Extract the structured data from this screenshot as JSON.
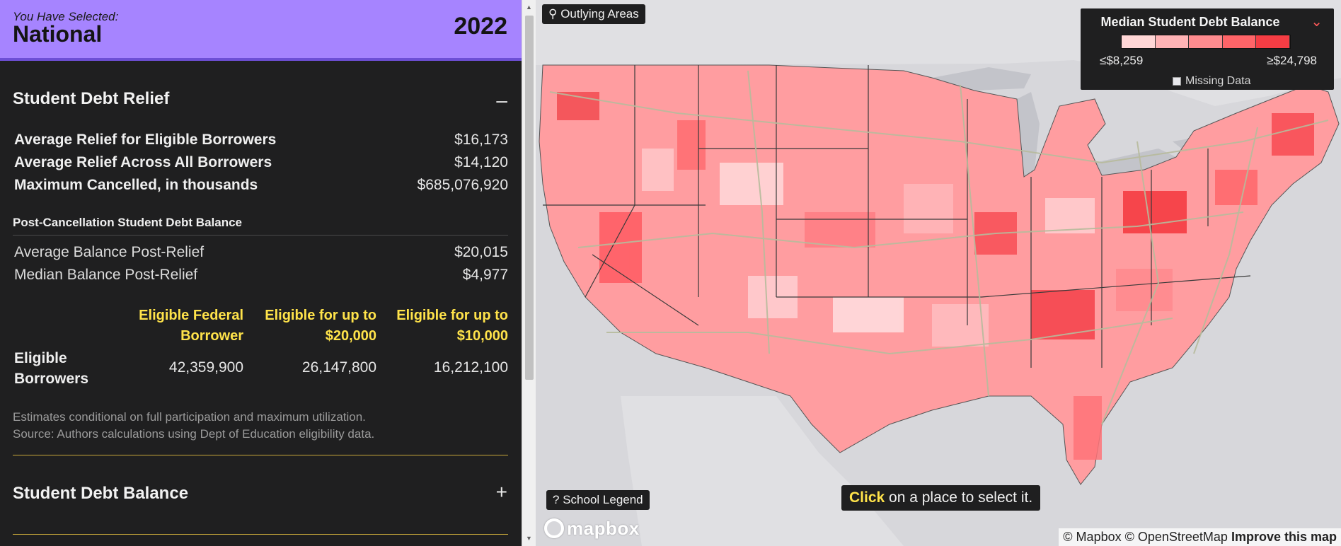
{
  "selection": {
    "kicker": "You Have Selected:",
    "name": "National",
    "year": "2022"
  },
  "relief": {
    "title": "Student Debt Relief",
    "toggle": "–",
    "stats": [
      {
        "label": "Average Relief for Eligible Borrowers",
        "value": "$16,173"
      },
      {
        "label": "Average Relief Across All Borrowers",
        "value": "$14,120"
      },
      {
        "label": "Maximum Cancelled, in thousands",
        "value": "$685,076,920"
      }
    ],
    "post_title": "Post-Cancellation Student Debt Balance",
    "post_stats": [
      {
        "label": "Average Balance Post-Relief",
        "value": "$20,015"
      },
      {
        "label": "Median Balance Post-Relief",
        "value": "$4,977"
      }
    ],
    "columns": [
      "Eligible Federal Borrower",
      "Eligible for up to $20,000",
      "Eligible for up to $10,000"
    ],
    "eligible_label": "Eligible Borrowers",
    "eligible_values": [
      "42,359,900",
      "26,147,800",
      "16,212,100"
    ],
    "note_1": "Estimates conditional on full participation and maximum utilization.",
    "note_2": "Source: Authors calculations using Dept of Education eligibility data."
  },
  "balance": {
    "title": "Student Debt Balance",
    "toggle": "+"
  },
  "map": {
    "outlying_label": "Outlying Areas",
    "school_legend_label": "School Legend",
    "click_hint_bold": "Click",
    "click_hint_rest": " on a place to select it.",
    "legend": {
      "title": "Median Student Debt Balance",
      "min_label": "≤$8,259",
      "max_label": "≥$24,798",
      "missing_label": "Missing Data",
      "colors": [
        "#ffd6d6",
        "#ffb3b5",
        "#ff8c8f",
        "#ff6468",
        "#f53d44"
      ]
    },
    "logo": "mapbox",
    "attribution": "© Mapbox © OpenStreetMap",
    "improve_link": "Improve this map"
  }
}
